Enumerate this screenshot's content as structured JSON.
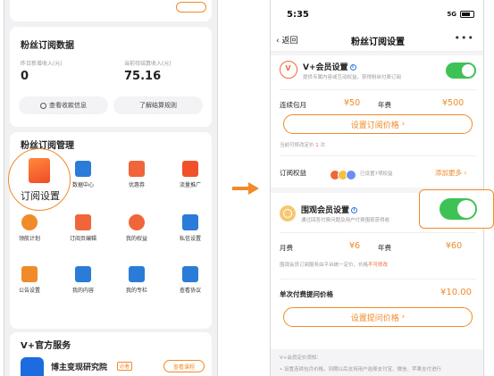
{
  "left": {
    "fans_data": {
      "title": "粉丝订阅数据",
      "yesterday_label": "昨日新增收入(元)",
      "yesterday_value": "0",
      "pending_label": "当前待结算收入(元)",
      "pending_value": "75.16",
      "view_income_btn": "查看收款信息",
      "rules_btn": "了解结算规则"
    },
    "manage": {
      "title": "粉丝订阅管理",
      "highlight_label": "订阅设置",
      "items": [
        {
          "label": "数据中心",
          "color": "#2b7bd8"
        },
        {
          "label": "优惠券",
          "color": "#f0663a"
        },
        {
          "label": "流量推广",
          "color": "#f0502a"
        },
        {
          "label": "领航计划",
          "color": "#f08a2a"
        },
        {
          "label": "订阅页编辑",
          "color": "#f0663a"
        },
        {
          "label": "我的权益",
          "color": "#f0663a"
        },
        {
          "label": "私信设置",
          "color": "#2b7bd8"
        },
        {
          "label": "公告设置",
          "color": "#f08a2a"
        },
        {
          "label": "我的内容",
          "color": "#2b7bd8"
        },
        {
          "label": "我的专栏",
          "color": "#2b7bd8"
        },
        {
          "label": "查看协议",
          "color": "#2b7bd8"
        }
      ]
    },
    "service": {
      "title": "V+官方服务",
      "name": "博主变现研究院",
      "badge": "必看",
      "cta": "查看课程"
    }
  },
  "right": {
    "status": {
      "time": "5:35",
      "network": "5G"
    },
    "nav": {
      "back": "返回",
      "title": "粉丝订阅设置",
      "more": "•••"
    },
    "vip": {
      "title": "V+会员设置",
      "subtitle": "提供专属内容或互动权益，获得粉丝付费订阅",
      "monthly_label": "连续包月",
      "monthly_price": "¥50",
      "yearly_label": "年费",
      "yearly_price": "¥500",
      "set_price_btn": "设置订阅价格",
      "modify_note": "当前可修改定价",
      "modify_count": "1",
      "modify_unit": "次",
      "rights_label": "订阅权益",
      "rights_note": "已设置7项权益",
      "add_more": "添加更多"
    },
    "surround": {
      "title": "围观会员设置",
      "subtitle": "通过回答付费问题及用户付费围观获得收",
      "monthly_label": "月费",
      "monthly_price": "¥6",
      "yearly_label": "年费",
      "yearly_price": "¥60",
      "price_note": "围观会员订阅服务由平台统一定价，价格",
      "price_note_red": "不可修改",
      "question_label": "单次付费提问价格",
      "question_price": "¥10.00",
      "set_question_btn": "设置提问价格"
    },
    "notes": {
      "title": "V+会员定价须知：",
      "line1": "设置连续包月价格，到期以后支持用户选择支付宝、微信、苹果支付进行"
    }
  }
}
